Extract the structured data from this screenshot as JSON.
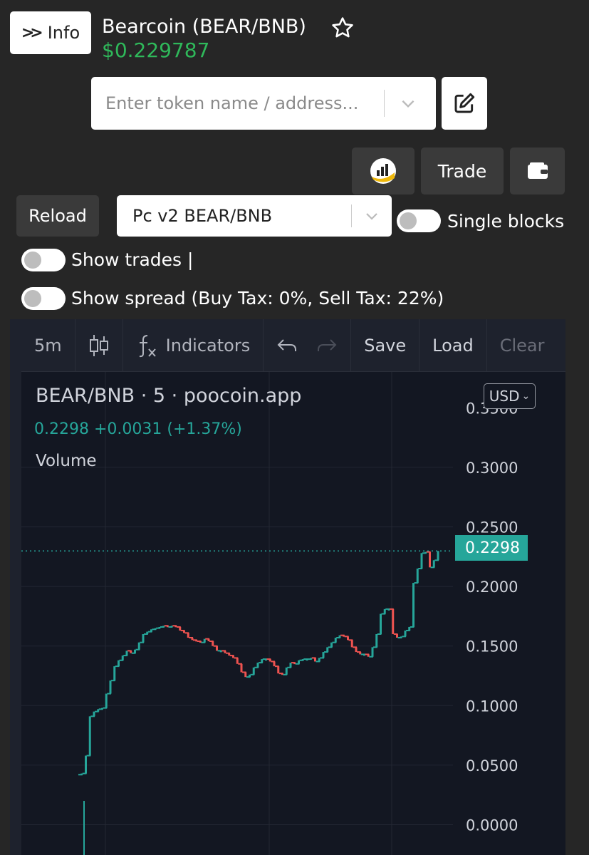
{
  "header": {
    "info_label": "Info",
    "token_title": "Bearcoin (BEAR/BNB)",
    "token_price": "$0.229787"
  },
  "search": {
    "placeholder": "Enter token name / address..."
  },
  "buttons": {
    "trade_label": "Trade",
    "reload_label": "Reload"
  },
  "pair_select": {
    "selected": "Pc v2 BEAR/BNB"
  },
  "toggles": {
    "single_blocks": {
      "label": "Single blocks",
      "on": false
    },
    "show_trades": {
      "label": "Show trades |",
      "on": false
    },
    "show_spread": {
      "label": "Show spread (Buy Tax: 0%, Sell Tax: 22%)",
      "on": false
    }
  },
  "tv_toolbar": {
    "interval": "5m",
    "indicators_label": "Indicators",
    "save_label": "Save",
    "load_label": "Load",
    "clear_label": "Clear"
  },
  "chart_legend": {
    "title": "BEAR/BNB · 5 · poocoin.app",
    "ohlc": "0.2298 +0.0031 (+1.37%)",
    "volume_label": "Volume",
    "currency": "USD"
  },
  "colors": {
    "up": "#26a69a",
    "down": "#ef5350",
    "price_green": "#2fb85a",
    "chart_bg": "#131722"
  },
  "chart_data": {
    "type": "line",
    "title": "BEAR/BNB · 5 · poocoin.app",
    "y_ticks": [
      "0.3000",
      "0.2500",
      "0.2000",
      "0.1500",
      "0.1000",
      "0.0500",
      "0.0000"
    ],
    "ylim": [
      0,
      0.35
    ],
    "last_price_label": "0.2298",
    "series": [
      {
        "values": [
          0.042,
          0.043,
          0.058,
          0.091,
          0.095,
          0.097,
          0.098,
          0.11,
          0.121,
          0.133,
          0.138,
          0.142,
          0.146,
          0.144,
          0.147,
          0.153,
          0.16,
          0.162,
          0.164,
          0.165,
          0.166,
          0.167,
          0.166,
          0.167,
          0.166,
          0.163,
          0.161,
          0.157,
          0.155,
          0.154,
          0.153,
          0.156,
          0.154,
          0.15,
          0.146,
          0.146,
          0.144,
          0.142,
          0.14,
          0.135,
          0.128,
          0.124,
          0.126,
          0.132,
          0.136,
          0.139,
          0.139,
          0.137,
          0.133,
          0.127,
          0.126,
          0.132,
          0.136,
          0.135,
          0.138,
          0.139,
          0.139,
          0.14,
          0.137,
          0.14,
          0.145,
          0.149,
          0.153,
          0.157,
          0.159,
          0.158,
          0.155,
          0.149,
          0.145,
          0.143,
          0.143,
          0.141,
          0.149,
          0.16,
          0.177,
          0.181,
          0.181,
          0.16,
          0.157,
          0.158,
          0.163,
          0.166,
          0.203,
          0.215,
          0.228,
          0.229,
          0.216,
          0.222,
          0.2298
        ]
      }
    ]
  }
}
